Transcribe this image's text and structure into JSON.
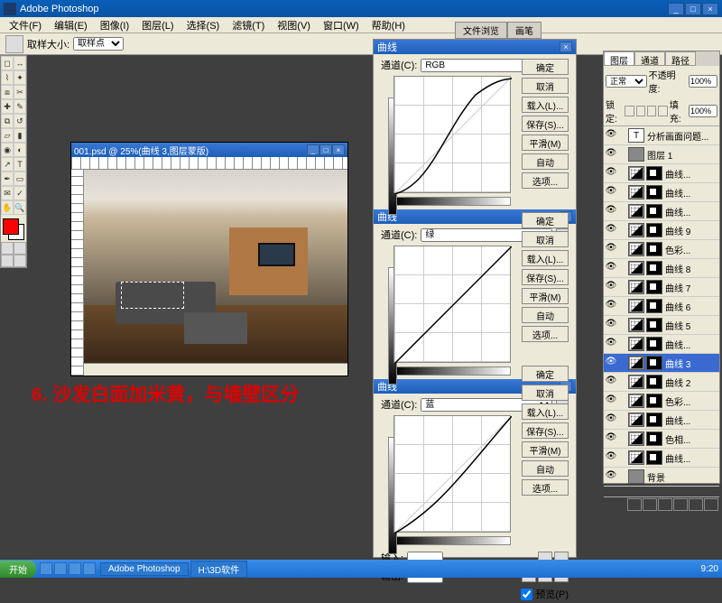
{
  "app": {
    "title": "Adobe Photoshop"
  },
  "menu": [
    "文件(F)",
    "编辑(E)",
    "图像(I)",
    "图层(L)",
    "选择(S)",
    "滤镜(T)",
    "视图(V)",
    "窗口(W)",
    "帮助(H)"
  ],
  "options": {
    "label": "取样大小:",
    "value": "取样点"
  },
  "doctabs": [
    "文件浏览",
    "画笔"
  ],
  "document": {
    "title": "001.psd @ 25%(曲线 3,图层蒙版)"
  },
  "annotation": "6. 沙发白面加米黄，与墙壁区分",
  "curves": {
    "title": "曲线",
    "channel_label": "通道(C):",
    "sections": [
      {
        "channel": "RGB"
      },
      {
        "channel": "绿"
      },
      {
        "channel": "蓝"
      }
    ],
    "buttons": [
      "确定",
      "取消",
      "载入(L)...",
      "保存(S)...",
      "平滑(M)",
      "自动",
      "选项..."
    ],
    "input_label": "输入:",
    "output_label": "输出:",
    "preview_label": "预览(P)"
  },
  "layers": {
    "tabs": [
      "图层",
      "通道",
      "路径"
    ],
    "blend": "正常",
    "opacity_label": "不透明度:",
    "opacity": "100%",
    "lock_label": "锁定:",
    "fill_label": "填充:",
    "fill": "100%",
    "items": [
      {
        "name": "分析画面问题...",
        "type": "txt"
      },
      {
        "name": "图层 1",
        "type": "img"
      },
      {
        "name": "曲线...",
        "type": "curve"
      },
      {
        "name": "曲线...",
        "type": "curve"
      },
      {
        "name": "曲线...",
        "type": "curve"
      },
      {
        "name": "曲线 9",
        "type": "curve"
      },
      {
        "name": "色彩...",
        "type": "adj"
      },
      {
        "name": "曲线 8",
        "type": "curve"
      },
      {
        "name": "曲线 7",
        "type": "curve"
      },
      {
        "name": "曲线 6",
        "type": "curve"
      },
      {
        "name": "曲线 5",
        "type": "curve"
      },
      {
        "name": "曲线...",
        "type": "curve"
      },
      {
        "name": "曲线 3",
        "type": "curve",
        "selected": true
      },
      {
        "name": "曲线 2",
        "type": "curve"
      },
      {
        "name": "色彩...",
        "type": "adj"
      },
      {
        "name": "曲线...",
        "type": "curve"
      },
      {
        "name": "色相...",
        "type": "adj"
      },
      {
        "name": "曲线...",
        "type": "curve"
      },
      {
        "name": "背景",
        "type": "bg"
      }
    ]
  },
  "taskbar": {
    "start": "开始",
    "tasks": [
      "Adobe Photoshop",
      "H:\\3D软件"
    ],
    "clock": "9:20"
  },
  "chart_data": [
    {
      "type": "line",
      "title": "曲线 RGB",
      "xlabel": "输入",
      "ylabel": "输出",
      "xlim": [
        0,
        255
      ],
      "ylim": [
        0,
        255
      ],
      "x": [
        0,
        50,
        110,
        170,
        255
      ],
      "values": [
        0,
        64,
        160,
        228,
        250
      ]
    },
    {
      "type": "line",
      "title": "曲线 绿",
      "xlabel": "输入",
      "ylabel": "输出",
      "xlim": [
        0,
        255
      ],
      "ylim": [
        0,
        255
      ],
      "x": [
        0,
        255
      ],
      "values": [
        0,
        255
      ]
    },
    {
      "type": "line",
      "title": "曲线 蓝",
      "xlabel": "输入",
      "ylabel": "输出",
      "xlim": [
        0,
        255
      ],
      "ylim": [
        0,
        255
      ],
      "x": [
        0,
        100,
        255
      ],
      "values": [
        0,
        80,
        255
      ]
    }
  ]
}
